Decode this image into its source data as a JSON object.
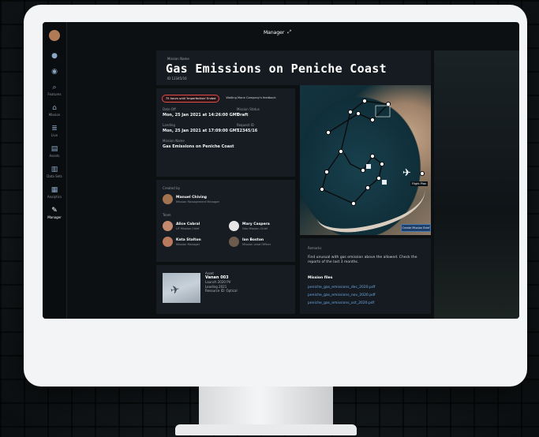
{
  "topbar": {
    "title": "Manager",
    "expand_icon": "expand-icon"
  },
  "rail": [
    {
      "icon": "avatar"
    },
    {
      "icon": "alert-icon",
      "label": ""
    },
    {
      "icon": "settings-icon",
      "label": ""
    },
    {
      "icon": "search-icon",
      "label": "Features"
    },
    {
      "icon": "home-icon",
      "label": "Mission"
    },
    {
      "icon": "layers-icon",
      "label": "Live"
    },
    {
      "icon": "device-icon",
      "label": "Assets"
    },
    {
      "icon": "sensor-icon",
      "label": "Data Sets"
    },
    {
      "icon": "grid-icon",
      "label": "Analytics"
    },
    {
      "icon": "pen-icon",
      "label": "Manager"
    }
  ],
  "header": {
    "eyebrow": "Mission Name",
    "title": "Gas Emissions on Peniche Coast",
    "sub": "ID 12345/16"
  },
  "details": {
    "badge1": "75 hours until 'Imperfection' Ended",
    "badge2": "Waiting Mane Company's feedback",
    "start_k": "Date Off",
    "start_v": "Mon, 25 Jan 2021 at 14:26:00 GMT",
    "status_k": "Mission Status",
    "status_v": "Draft",
    "landing_k": "Landing",
    "landing_v": "Mon, 25 Jan 2021 at 17:09:00 GMT",
    "req_k": "Request ID",
    "req_v": "12345/16",
    "name_k": "Mission Name",
    "name_v": "Gas Emissions on Peniche Coast"
  },
  "people": {
    "created_label": "Created by",
    "creator": {
      "name": "Manuel Chiving",
      "role": "Mission Management Manager"
    },
    "team_label": "Team",
    "team": [
      {
        "name": "Alice Cabral",
        "role": "UF Mission Chief"
      },
      {
        "name": "Mary Caspera",
        "role": "Geo Mission Chief"
      },
      {
        "name": "Kata Stalton",
        "role": "Mission Manager"
      },
      {
        "name": "Ian Boston",
        "role": "Mission Lead Officer"
      }
    ]
  },
  "asset": {
    "label": "Asset",
    "name": "Vanan 003",
    "l1": "Launch 2020 PV",
    "l2": "Leading 2021",
    "l3": "Resource ID: Optical"
  },
  "map": {
    "flight_label": "Flight Plan",
    "button": "Create Mission Brief"
  },
  "notes": {
    "label": "Remarks",
    "text": "Find unusual with gas emission above the allowed. Check the reports of the last 3 months.",
    "files_label": "Mission files",
    "files": [
      "peniche_gas_emissions_dec_2020.pdf",
      "peniche_gas_emissions_nov_2020.pdf",
      "peniche_gas_emissions_oct_2020.pdf"
    ]
  },
  "colors": {
    "accent": "#6fa9e6",
    "alert": "#e24a4a",
    "panel": "#161c21"
  }
}
